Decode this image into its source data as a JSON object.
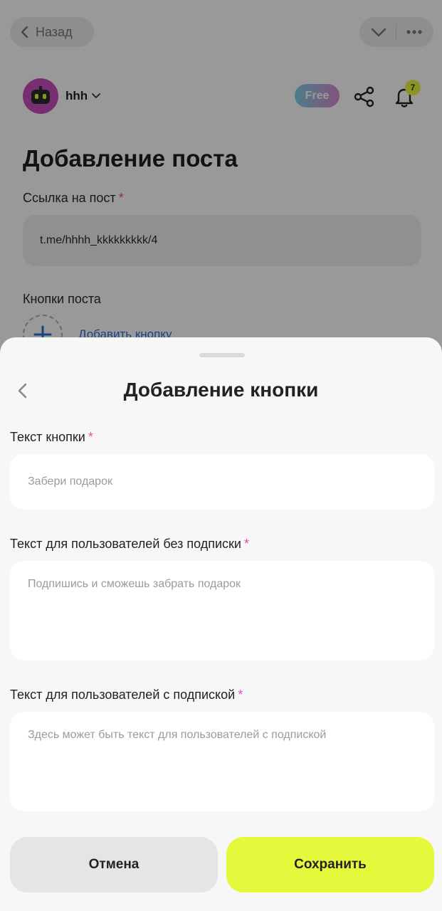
{
  "topbar": {
    "back_label": "Назад"
  },
  "account": {
    "name": "hhh",
    "plan_badge": "Free",
    "notifications_count": "7"
  },
  "page": {
    "title": "Добавление поста",
    "post_link_label": "Ссылка на пост",
    "post_link_value": "t.me/hhhh_kkkkkkkkk/4",
    "post_buttons_label": "Кнопки поста",
    "add_button_label": "Добавить кнопку"
  },
  "sheet": {
    "title": "Добавление кнопки",
    "required_mark": "*",
    "fields": [
      {
        "label": "Текст кнопки",
        "placeholder": "Забери подарок"
      },
      {
        "label": "Текст для пользователей без подписки",
        "placeholder": "Подпишись и сможешь забрать подарок"
      },
      {
        "label": "Текст для пользователей с подпиской",
        "placeholder": "Здесь может быть текст для пользователей с подпиской"
      }
    ],
    "cancel_label": "Отмена",
    "save_label": "Сохранить"
  },
  "colors": {
    "accent": "#e6f83b",
    "required": "#e04fb0",
    "link": "#2f6fd8"
  }
}
